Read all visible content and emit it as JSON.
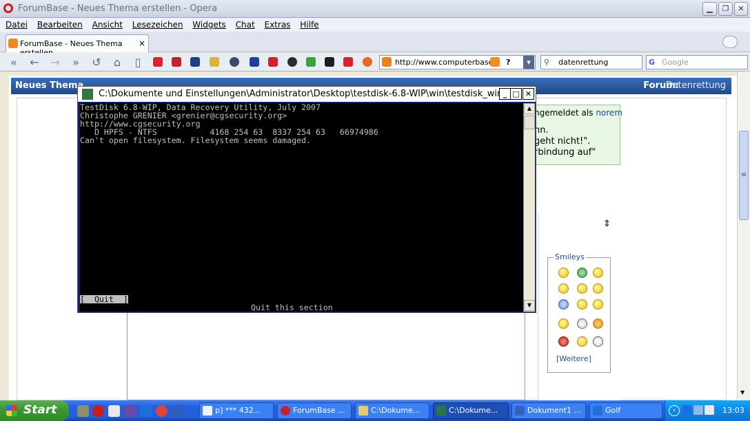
{
  "browser": {
    "title": "ForumBase - Neues Thema erstellen - Opera",
    "menu": [
      "Datei",
      "Bearbeiten",
      "Ansicht",
      "Lesezeichen",
      "Widgets",
      "Chat",
      "Extras",
      "Hilfe"
    ],
    "tab": {
      "label": "ForumBase - Neues Thema erstellen",
      "close": "×"
    },
    "address": "http://www.computerbase.",
    "search_value": "datenrettung",
    "google_placeholder": "Google"
  },
  "page": {
    "heading_left": "Neues Thema",
    "forum_label": "Forum:",
    "forum_value": "Datenrettung",
    "login_fragment": "ngemeldet als",
    "login_user": "norem",
    "green_lines": [
      "nn.",
      "geht nicht!\".",
      "rbindung auf\""
    ],
    "smileys_legend": "Smileys",
    "more_smileys": "[Weitere]",
    "resize_glyph": "⇕"
  },
  "console": {
    "title": "C:\\Dokumente und Einstellungen\\Administrator\\Desktop\\testdisk-6.8-WIP\\win\\testdisk_win...",
    "lines": [
      "TestDisk 6.8-WIP, Data Recovery Utility, July 2007",
      "Christophe GRENIER <grenier@cgsecurity.org>",
      "http://www.cgsecurity.org",
      "",
      "   D HPFS - NTFS           4168 254 63  8337 254 63   66974986",
      "",
      "",
      "",
      "Can't open filesystem. Filesystem seems damaged."
    ],
    "menu_item": "[  Quit  ]",
    "status": "Quit this section"
  },
  "taskbar": {
    "start": "Start",
    "tasks": [
      "p] *** 432...",
      "ForumBase ...",
      "C:\\Dokume...",
      "C:\\Dokume...",
      "Dokument1 ...",
      "Golf"
    ],
    "clock": "13:03"
  },
  "colors": {
    "xp_blue": "#245edc",
    "start_green": "#3c9a34",
    "page_header": "#1e4a8e",
    "link_blue": "#1e4a8e"
  }
}
